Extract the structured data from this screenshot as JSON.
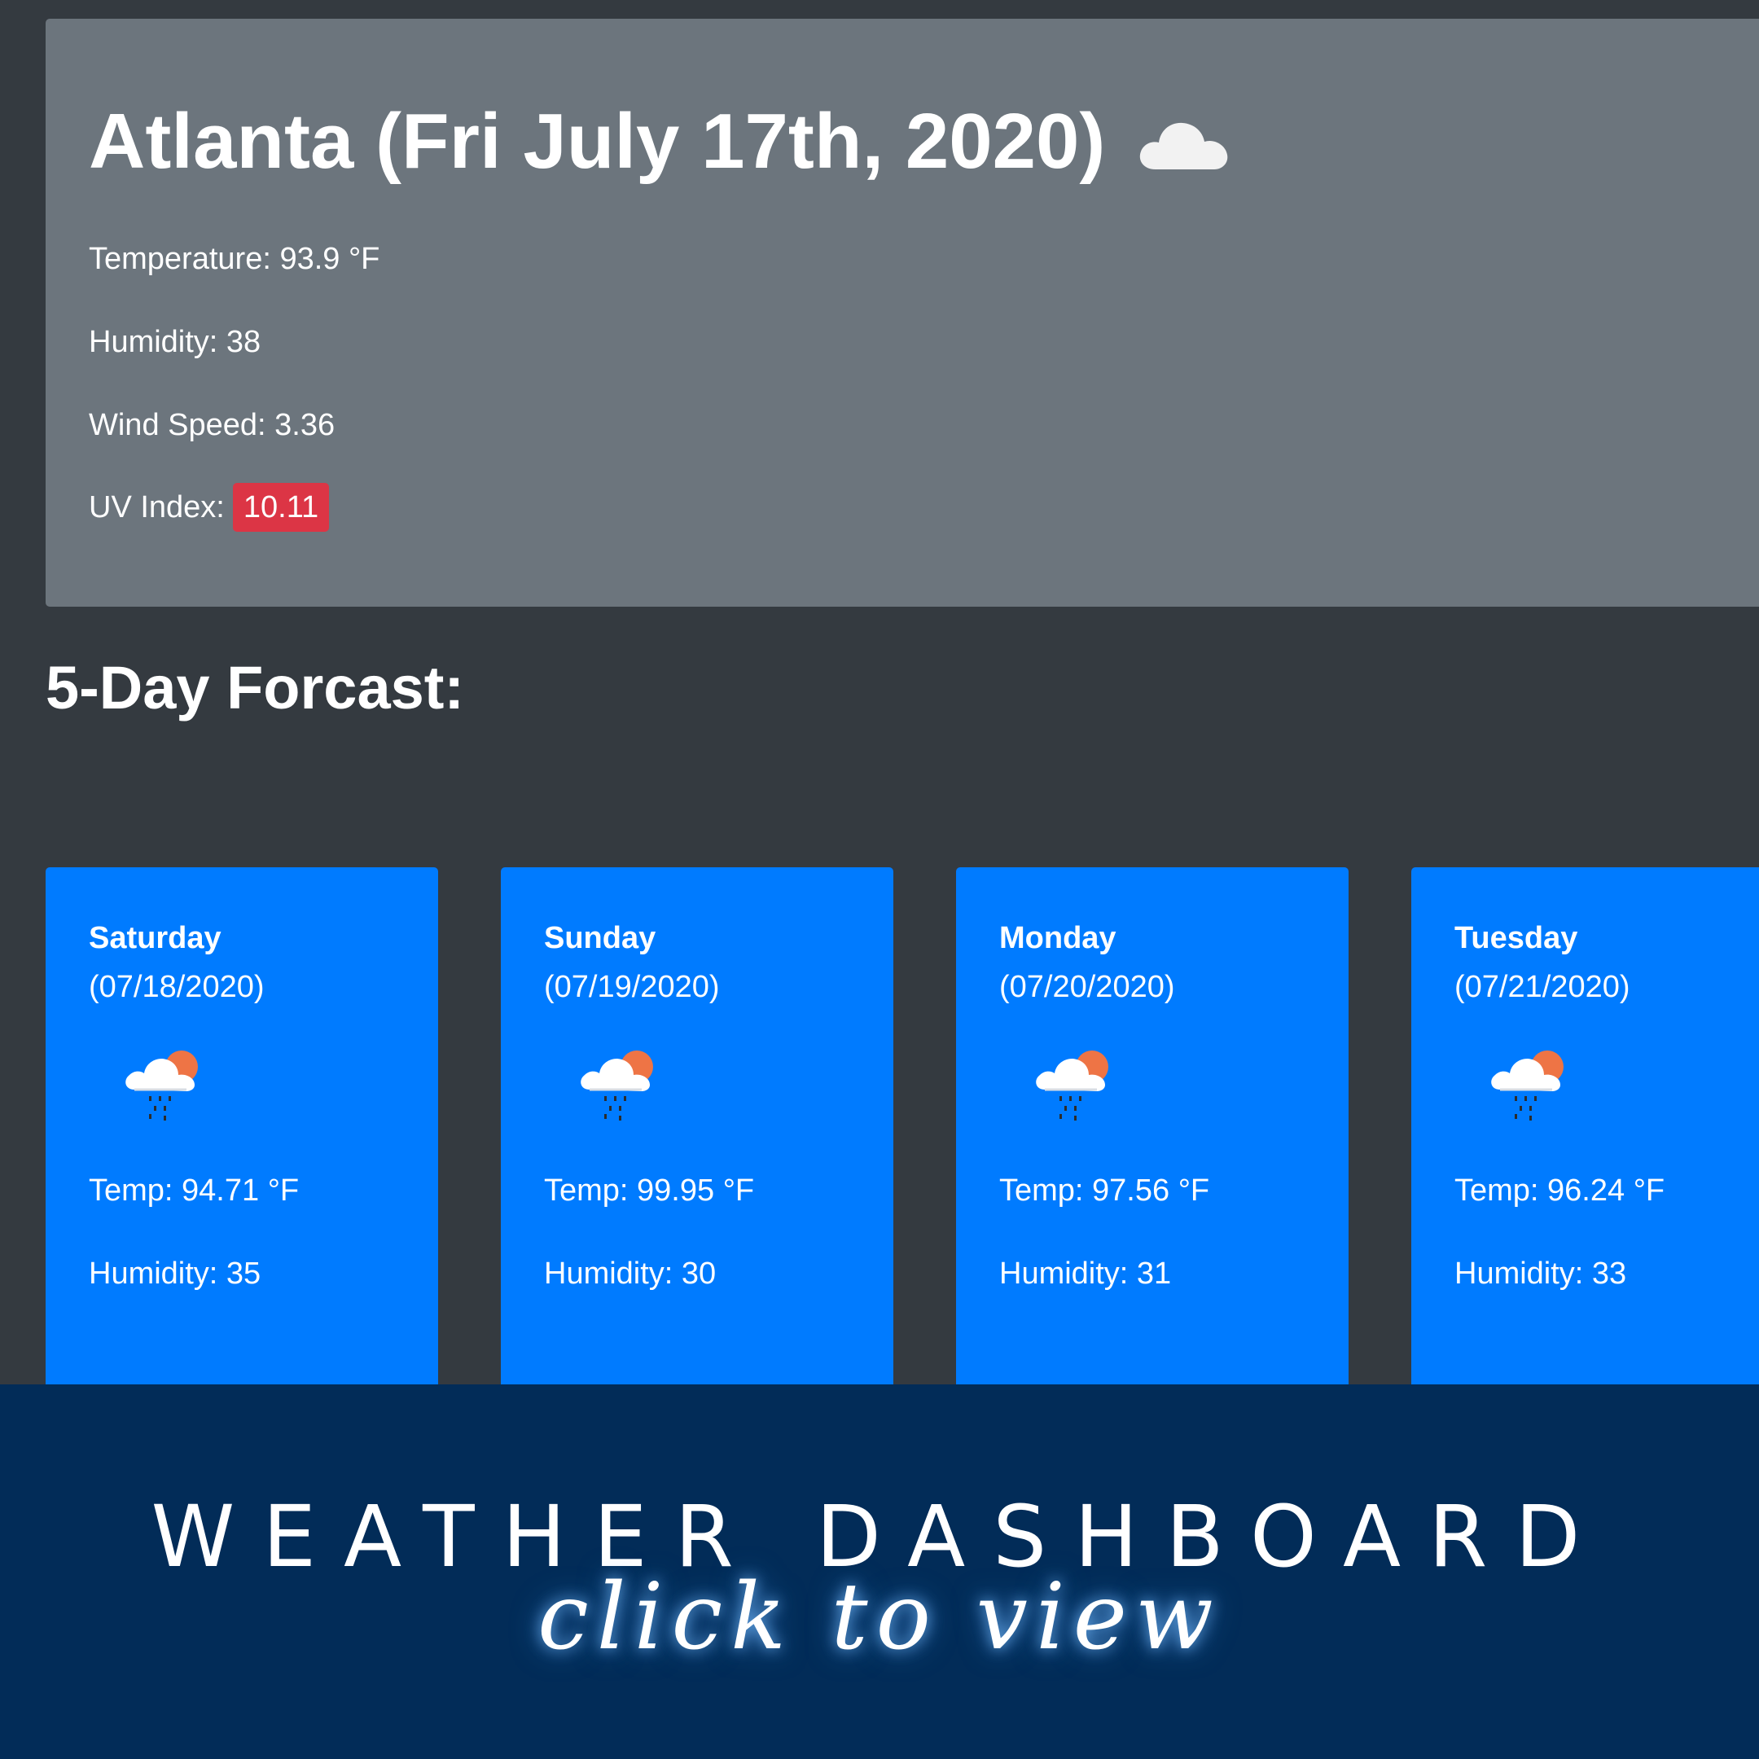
{
  "current": {
    "title": "Atlanta (Fri July 17th, 2020)",
    "icon": "cloud-icon",
    "temperature": "Temperature: 93.9 °F",
    "humidity": "Humidity: 38",
    "wind_speed": "Wind Speed: 3.36",
    "uv_label": "UV Index:",
    "uv_value": "10.11",
    "uv_color": "#dc3545"
  },
  "forecast": {
    "heading": "5-Day Forcast:",
    "card_color": "#007bff",
    "days": [
      {
        "day": "Saturday",
        "date": "(07/18/2020)",
        "icon": "rain-sun-cloud-icon",
        "temp": "Temp: 94.71 °F",
        "humidity": "Humidity: 35"
      },
      {
        "day": "Sunday",
        "date": "(07/19/2020)",
        "icon": "rain-sun-cloud-icon",
        "temp": "Temp: 99.95 °F",
        "humidity": "Humidity: 30"
      },
      {
        "day": "Monday",
        "date": "(07/20/2020)",
        "icon": "rain-sun-cloud-icon",
        "temp": "Temp: 97.56 °F",
        "humidity": "Humidity: 31"
      },
      {
        "day": "Tuesday",
        "date": "(07/21/2020)",
        "icon": "rain-sun-cloud-icon",
        "temp": "Temp: 96.24 °F",
        "humidity": "Humidity: 33"
      }
    ]
  },
  "banner": {
    "title": "WEATHER DASHBOARD",
    "subtitle": "click to view",
    "background": "#022c58"
  }
}
